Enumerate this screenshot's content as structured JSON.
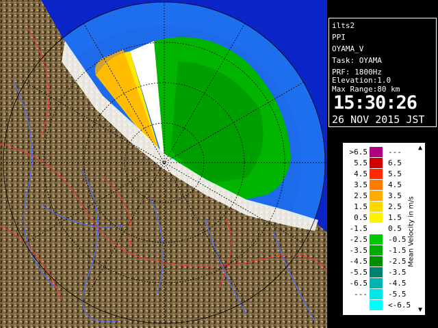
{
  "info": {
    "user": "ilts2",
    "product": "PPI",
    "site_var": "OYAMA_V",
    "task": "Task: OYAMA",
    "prf": "PRF: 1800Hz",
    "elevation": "Elevation:1.0",
    "max_range": "Max Range:80 km",
    "time": "15:30:26",
    "date": "26 NOV 2015 JST"
  },
  "legend": {
    "title": "Mean Velocity in m/s",
    "rows": [
      {
        "lo": ">6.5",
        "hi": "---",
        "color": "#b0007a"
      },
      {
        "lo": "5.5",
        "hi": "6.5",
        "color": "#d00000"
      },
      {
        "lo": "4.5",
        "hi": "5.5",
        "color": "#ff2a00"
      },
      {
        "lo": "3.5",
        "hi": "4.5",
        "color": "#ff7a00"
      },
      {
        "lo": "2.5",
        "hi": "3.5",
        "color": "#ffae00"
      },
      {
        "lo": "1.5",
        "hi": "2.5",
        "color": "#ffd800"
      },
      {
        "lo": "0.5",
        "hi": "1.5",
        "color": "#fff200"
      },
      {
        "lo": "-1.5",
        "hi": "0.5",
        "color": "#ffffff"
      },
      {
        "lo": "-2.5",
        "hi": "-0.5",
        "color": "#00c800"
      },
      {
        "lo": "-3.5",
        "hi": "-1.5",
        "color": "#00aa00"
      },
      {
        "lo": "-4.5",
        "hi": "-2.5",
        "color": "#008c00"
      },
      {
        "lo": "-5.5",
        "hi": "-3.5",
        "color": "#00806e"
      },
      {
        "lo": "-6.5",
        "hi": "-4.5",
        "color": "#00b4b4"
      },
      {
        "lo": "---",
        "hi": "-5.5",
        "color": "#00e6e6"
      },
      {
        "lo": "",
        "hi": "<-6.5",
        "color": "#00ffff"
      }
    ]
  },
  "colors": {
    "sea_outer": "#1e5fe0",
    "sea_inner": "#3c8cff",
    "land": "#6b5634",
    "rivers": "#4a6cff",
    "borders": "#ff3030",
    "grid": "#000000"
  }
}
